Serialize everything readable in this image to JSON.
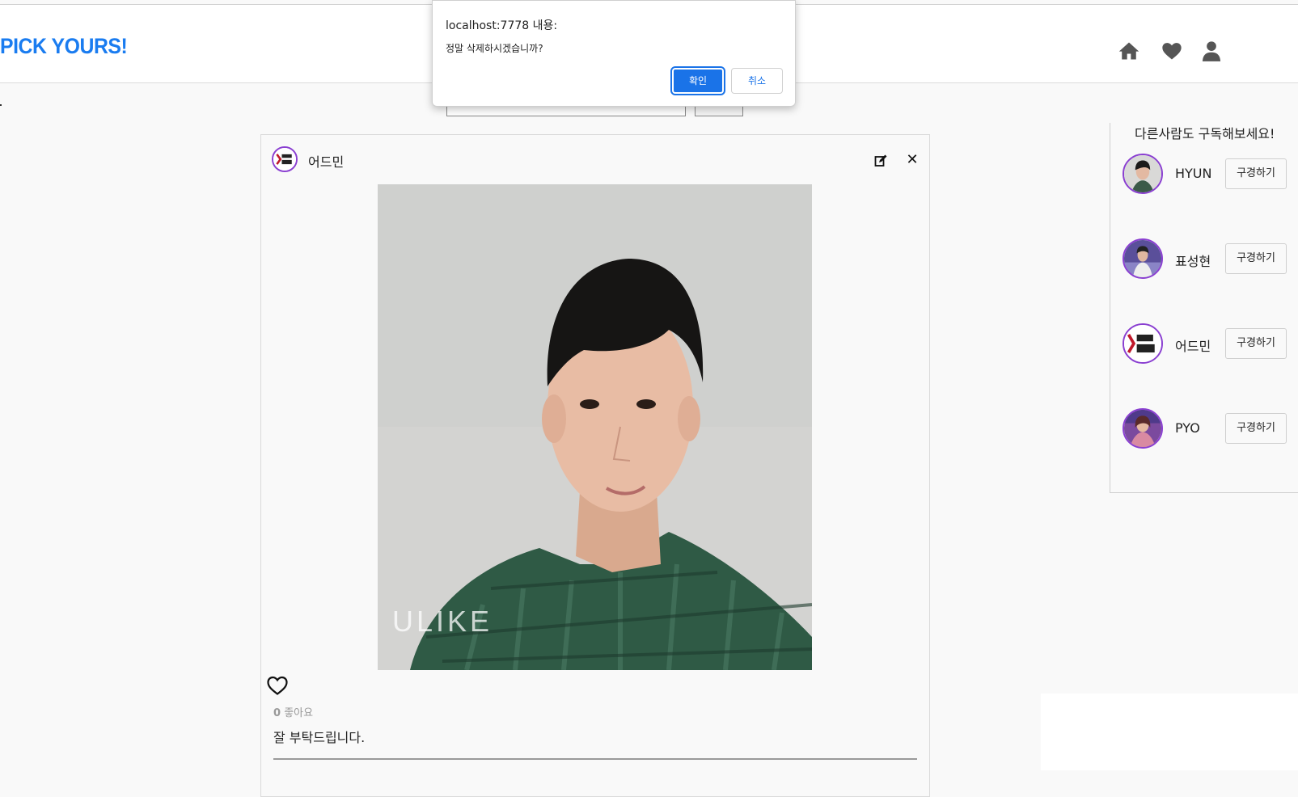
{
  "header": {
    "logo": "PICK YOURS!",
    "nav_icons": [
      "home-icon",
      "heart-icon",
      "user-icon"
    ]
  },
  "search": {
    "placeholder": ""
  },
  "post": {
    "author": "어드민",
    "likes_count": "0",
    "likes_label": "좋아요",
    "caption": "잘 부탁드립니다.",
    "photo_watermark": "ULIKE"
  },
  "suggestions": {
    "title": "다른사람도 구독해보세요!",
    "users": [
      {
        "name": "HYUN",
        "button": "구경하기"
      },
      {
        "name": "표성현",
        "button": "구경하기"
      },
      {
        "name": "어드민",
        "button": "구경하기"
      },
      {
        "name": "PYO",
        "button": "구경하기"
      }
    ]
  },
  "dialog": {
    "title": "localhost:7778 내용:",
    "message": "정말 삭제하시겠습니까?",
    "ok": "확인",
    "cancel": "취소"
  },
  "colors": {
    "brand": "#1a7cf0",
    "avatar_ring": "#8a3fd1",
    "dialog_primary": "#1a73e8"
  }
}
